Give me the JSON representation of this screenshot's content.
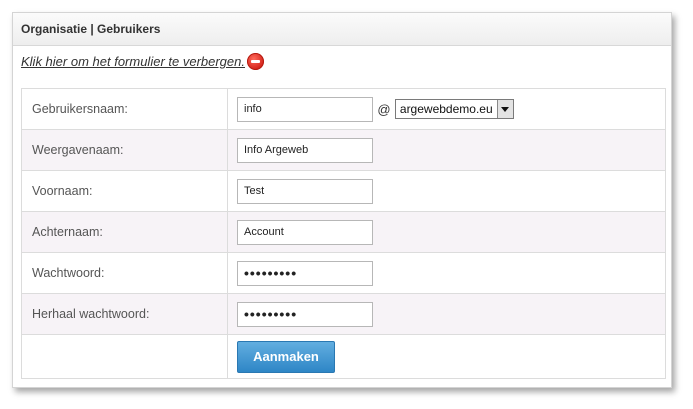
{
  "header": {
    "title": "Organisatie | Gebruikers"
  },
  "toggle": {
    "label": "Klik hier om het formulier te verbergen."
  },
  "form": {
    "username": {
      "label": "Gebruikersnaam:",
      "value": "info",
      "at": "@",
      "domain": "argewebdemo.eu"
    },
    "display_name": {
      "label": "Weergavenaam:",
      "value": "Info Argeweb"
    },
    "first_name": {
      "label": "Voornaam:",
      "value": "Test"
    },
    "last_name": {
      "label": "Achternaam:",
      "value": "Account"
    },
    "password": {
      "label": "Wachtwoord:",
      "value": "•••••••••"
    },
    "password_repeat": {
      "label": "Herhaal wachtwoord:",
      "value": "•••••••••"
    },
    "submit_label": "Aanmaken"
  },
  "colors": {
    "accent": "#3a8fd0",
    "danger": "#d4231a"
  },
  "icons": {
    "toggle": "remove-circle-icon",
    "dropdown": "chevron-down-icon"
  }
}
